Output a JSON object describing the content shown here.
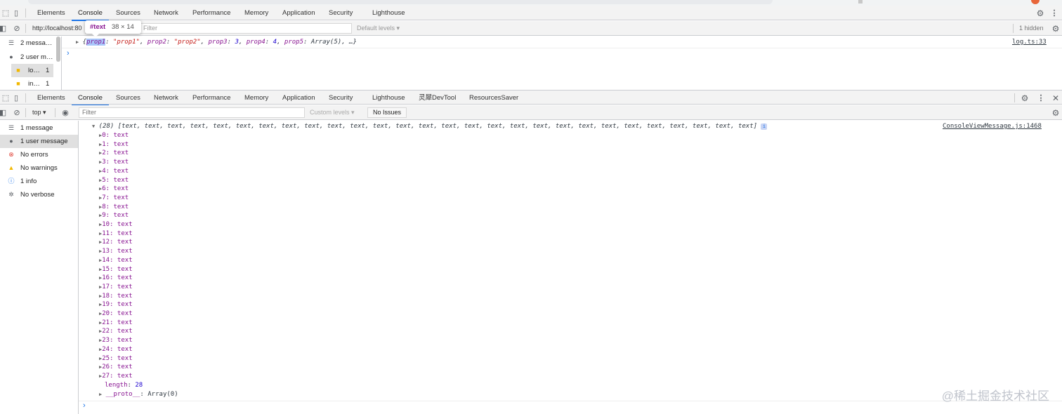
{
  "panel1": {
    "tabs": [
      "Elements",
      "Console",
      "Sources",
      "Network",
      "Performance",
      "Memory",
      "Application",
      "Security",
      "Lighthouse"
    ],
    "active_tab": "Console",
    "url_text": "http://localhost:80",
    "filter_placeholder": "Filter",
    "levels": "Default levels ▾",
    "hidden": "1 hidden",
    "sidebar": [
      {
        "icon": "list-icon",
        "label": "2 messa…",
        "count": ""
      },
      {
        "icon": "user-icon",
        "label": "2 user m…",
        "count": ""
      },
      {
        "icon": "file-icon",
        "label": "lo…",
        "count": "1"
      },
      {
        "icon": "file-icon",
        "label": "in…",
        "count": "1"
      }
    ],
    "log": {
      "open": "{",
      "highlight": "prop1",
      "rest_before": ": ",
      "prop1_val": "\"prop1\"",
      "p2": "prop2",
      "p2v": "\"prop2\"",
      "p3": "prop3",
      "p3v": "3",
      "p4": "prop4",
      "p4v": "4",
      "p5": "prop5",
      "p5v": "Array(5)",
      "tail": ", …}",
      "source": "log.ts:33"
    },
    "tooltip": {
      "tag": "#text",
      "size": "38 × 14"
    }
  },
  "panel2": {
    "tabs": [
      "Elements",
      "Console",
      "Sources",
      "Network",
      "Performance",
      "Memory",
      "Application",
      "Security",
      "Lighthouse",
      "灵犀DevTool",
      "ResourcesSaver"
    ],
    "active_tab": "Console",
    "context": "top ▾",
    "filter_placeholder": "Filter",
    "levels": "Custom levels ▾",
    "no_issues": "No Issues",
    "sidebar": [
      {
        "icon": "list-icon",
        "label": "1 message"
      },
      {
        "icon": "user-icon",
        "label": "1 user message"
      },
      {
        "icon": "error-icon",
        "label": "No errors"
      },
      {
        "icon": "warning-icon",
        "label": "No warnings"
      },
      {
        "icon": "info-icon",
        "label": "1 info"
      },
      {
        "icon": "gear-bug-icon",
        "label": "No verbose"
      }
    ],
    "array_header": "(28) [text, text, text, text, text, text, text, text, text, text, text, text, text, text, text, text, text, text, text, text, text, text, text, text, text, text, text, text]",
    "source": "ConsoleViewMessage.js:1468",
    "item_value": "text",
    "item_count": 28,
    "length_label": "length",
    "length_value": "28",
    "proto_label": "__proto__",
    "proto_value": "Array(0)"
  },
  "watermark": "@稀土掘金技术社区",
  "colors": {
    "accent": "#1a73e8",
    "error": "#e0453b",
    "warning": "#f2b800",
    "info": "#1a73e8"
  }
}
